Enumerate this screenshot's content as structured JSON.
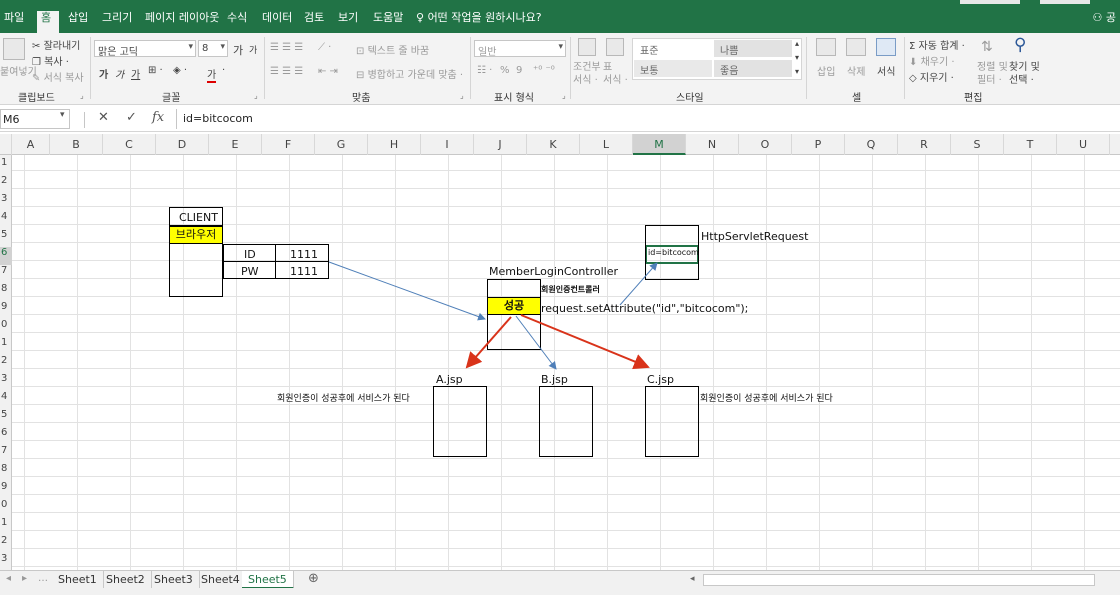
{
  "menu": {
    "tabs": [
      "파일",
      "홈",
      "삽입",
      "그리기",
      "페이지 레이아웃",
      "수식",
      "데이터",
      "검토",
      "보기",
      "도움말"
    ],
    "tell_me": "어떤 작업을 원하시나요?",
    "account": "공"
  },
  "ribbon": {
    "clipboard": {
      "paste": "붙여넣기",
      "cut": "잘라내기",
      "copy": "복사 ·",
      "format_painter": "서식 복사",
      "label": "클립보드"
    },
    "font": {
      "name": "맑은 고딕",
      "size": "8",
      "grow": "가",
      "shrink": "가",
      "bold": "가",
      "italic": "가",
      "underline": "가",
      "font_color": "가",
      "label": "글꼴"
    },
    "alignment": {
      "wrap": "텍스트 줄 바꿈",
      "merge": "병합하고 가운데 맞춤 ·",
      "label": "맞춤"
    },
    "number": {
      "format": "일반",
      "percent": "%",
      "comma": "9",
      "label": "표시 형식"
    },
    "styles": {
      "conditional": "조건부\n서식 ·",
      "table": "표\n서식 ·",
      "normal": "표준",
      "bad": "나쁨",
      "neutral": "보통",
      "good": "좋음",
      "label": "스타일"
    },
    "cells": {
      "insert": "삽입",
      "delete": "삭제",
      "format": "서식",
      "label": "셀"
    },
    "editing": {
      "autosum": "Σ 자동 합계 ·",
      "fill": "채우기 ·",
      "clear": "지우기 ·",
      "sort": "정렬 및\n필터 ·",
      "find": "찾기 및\n선택 ·",
      "label": "편집"
    }
  },
  "formula_bar": {
    "name_box": "M6",
    "cancel": "✕",
    "enter": "✓",
    "fx": "fx",
    "formula": "id=bitcocom"
  },
  "columns": [
    "A",
    "B",
    "C",
    "D",
    "E",
    "F",
    "G",
    "H",
    "I",
    "J",
    "K",
    "L",
    "M",
    "N",
    "O",
    "P",
    "Q",
    "R",
    "S",
    "T",
    "U"
  ],
  "rows": [
    "1",
    "2",
    "3",
    "4",
    "5",
    "6",
    "7",
    "8",
    "9",
    "0",
    "1",
    "2",
    "3",
    "4",
    "5",
    "6",
    "7",
    "8",
    "9",
    "0",
    "1",
    "2",
    "3"
  ],
  "selected_column": "M",
  "selected_row_index": 5,
  "diagram": {
    "client": "CLIENT",
    "browser": "브라우저",
    "id_label": "ID",
    "id_value": "1111",
    "pw_label": "PW",
    "pw_value": "1111",
    "controller": "MemberLoginController",
    "controller_kr": "회원인증컨트롤러",
    "success": "성공",
    "set_attr": "request.setAttribute(\"id\",\"bitcocom\");",
    "request": "HttpServletRequest",
    "request_value": "id=bitcocom",
    "a_jsp": "A.jsp",
    "b_jsp": "B.jsp",
    "c_jsp": "C.jsp",
    "note_left": "회원인증이 성공후에 서비스가 된다",
    "note_right": "회원인증이 성공후에 서비스가 된다"
  },
  "sheets": [
    "Sheet1",
    "Sheet2",
    "Sheet3",
    "Sheet4",
    "Sheet5"
  ],
  "active_sheet": "Sheet5",
  "add_sheet": "⊕",
  "colors": {
    "excel_green": "#217346",
    "highlight": "#ffff00",
    "red_arrow": "#d9331a",
    "blue_arrow": "#4f7fb8"
  }
}
